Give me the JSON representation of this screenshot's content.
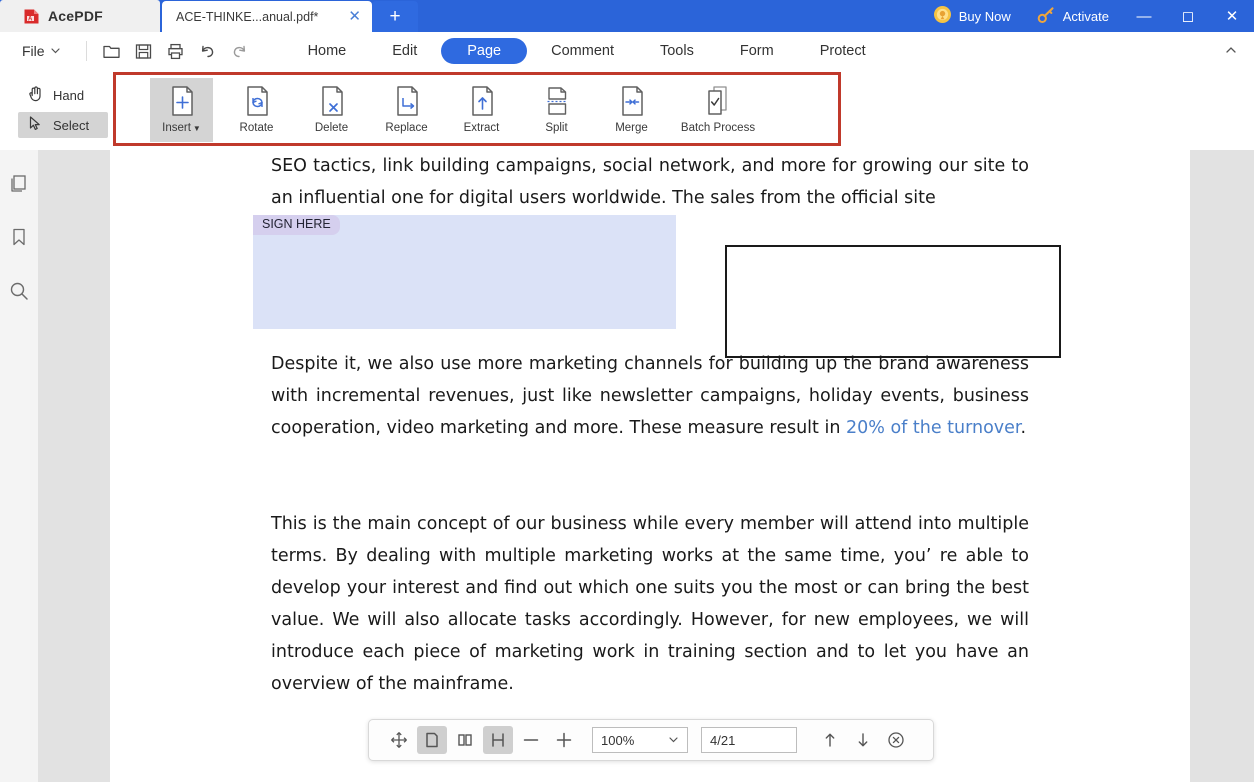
{
  "titlebar": {
    "brand": "AcePDF",
    "brand_logo_icon": "acepdf-logo-icon",
    "doc_tab_label": "ACE-THINKE...anual.pdf*",
    "doc_tab_close_icon": "close-icon",
    "new_tab_icon": "plus-icon",
    "buy_now_label": "Buy Now",
    "buy_now_icon": "coin-icon",
    "activate_label": "Activate",
    "activate_icon": "key-icon",
    "minimize_icon": "minimize-icon",
    "maximize_icon": "maximize-icon",
    "close_icon": "close-icon",
    "accent_blue": "#2b64d9"
  },
  "menubar": {
    "file_label": "File",
    "file_chevron_icon": "chevron-down-icon",
    "quick_actions": [
      {
        "name": "open-folder-icon",
        "label": "Open"
      },
      {
        "name": "save-icon",
        "label": "Save"
      },
      {
        "name": "print-icon",
        "label": "Print"
      },
      {
        "name": "undo-icon",
        "label": "Undo"
      },
      {
        "name": "redo-icon",
        "label": "Redo"
      }
    ],
    "tabs": [
      {
        "label": "Home",
        "active": false
      },
      {
        "label": "Edit",
        "active": false
      },
      {
        "label": "Page",
        "active": true
      },
      {
        "label": "Comment",
        "active": false
      },
      {
        "label": "Tools",
        "active": false
      },
      {
        "label": "Form",
        "active": false
      },
      {
        "label": "Protect",
        "active": false
      }
    ],
    "collapse_icon": "chevron-up-icon",
    "active_tab_color": "#2f6ae0"
  },
  "mode_tools": [
    {
      "label": "Hand",
      "icon": "hand-icon",
      "active": false
    },
    {
      "label": "Select",
      "icon": "cursor-arrow-icon",
      "active": true
    }
  ],
  "ribbon": {
    "highlight_border_color": "#c0392b",
    "items": [
      {
        "label": "Insert",
        "icon": "page-insert-icon",
        "has_dropdown": true,
        "selected": true
      },
      {
        "label": "Rotate",
        "icon": "page-rotate-icon",
        "has_dropdown": false,
        "selected": false
      },
      {
        "label": "Delete",
        "icon": "page-delete-icon",
        "has_dropdown": false,
        "selected": false
      },
      {
        "label": "Replace",
        "icon": "page-replace-icon",
        "has_dropdown": false,
        "selected": false
      },
      {
        "label": "Extract",
        "icon": "page-extract-icon",
        "has_dropdown": false,
        "selected": false
      },
      {
        "label": "Split",
        "icon": "page-split-icon",
        "has_dropdown": false,
        "selected": false
      },
      {
        "label": "Merge",
        "icon": "page-merge-icon",
        "has_dropdown": false,
        "selected": false
      },
      {
        "label": "Batch Process",
        "icon": "batch-process-icon",
        "has_dropdown": false,
        "selected": false
      }
    ]
  },
  "sidebar": {
    "items": [
      {
        "icon": "thumbnails-icon",
        "label": "Page Thumbnails"
      },
      {
        "icon": "bookmark-icon",
        "label": "Bookmarks"
      },
      {
        "icon": "search-icon",
        "label": "Search"
      }
    ]
  },
  "document": {
    "paragraph1": "SEO tactics, link building campaigns, social network, and more for growing our site to an influential one for digital users worldwide. The sales from the official site",
    "signature_field_label": "SIGN HERE",
    "paragraph2_part1": "Despite it, we also use more marketing channels for building up the brand awareness with incremental revenues, just like newsletter campaigns, holiday events, business cooperation, video marketing and more. These measure result in ",
    "paragraph2_link": "20% of the turnover",
    "paragraph2_end": ".",
    "paragraph3": "This is the main concept of our business while every member will attend into multiple terms. By dealing with multiple marketing works at the same time, you’ re able to develop your interest and find out which one suits you the most or can bring the best value. We will also allocate tasks accordingly. However, for new employees, we will introduce each piece of marketing work in training section and to let you have an overview of the mainframe.",
    "rectangle_annotation": "rectangle-annotation"
  },
  "floatbar": {
    "buttons": [
      {
        "icon": "move-pan-icon",
        "label": "Pan",
        "active": false
      },
      {
        "icon": "single-page-view-icon",
        "label": "Single Page View",
        "active": true
      },
      {
        "icon": "two-page-view-icon",
        "label": "Two Page View",
        "active": false
      },
      {
        "icon": "continuous-scroll-icon",
        "label": "Continuous Scroll",
        "active": true
      },
      {
        "icon": "zoom-out-icon",
        "label": "Zoom Out",
        "active": false
      },
      {
        "icon": "zoom-in-icon",
        "label": "Zoom In",
        "active": false
      }
    ],
    "zoom_value": "100%",
    "zoom_chevron_icon": "chevron-down-icon",
    "page_value": "4/21",
    "prev_page_icon": "arrow-up-icon",
    "next_page_icon": "arrow-down-icon",
    "close_icon": "close-circle-icon"
  }
}
